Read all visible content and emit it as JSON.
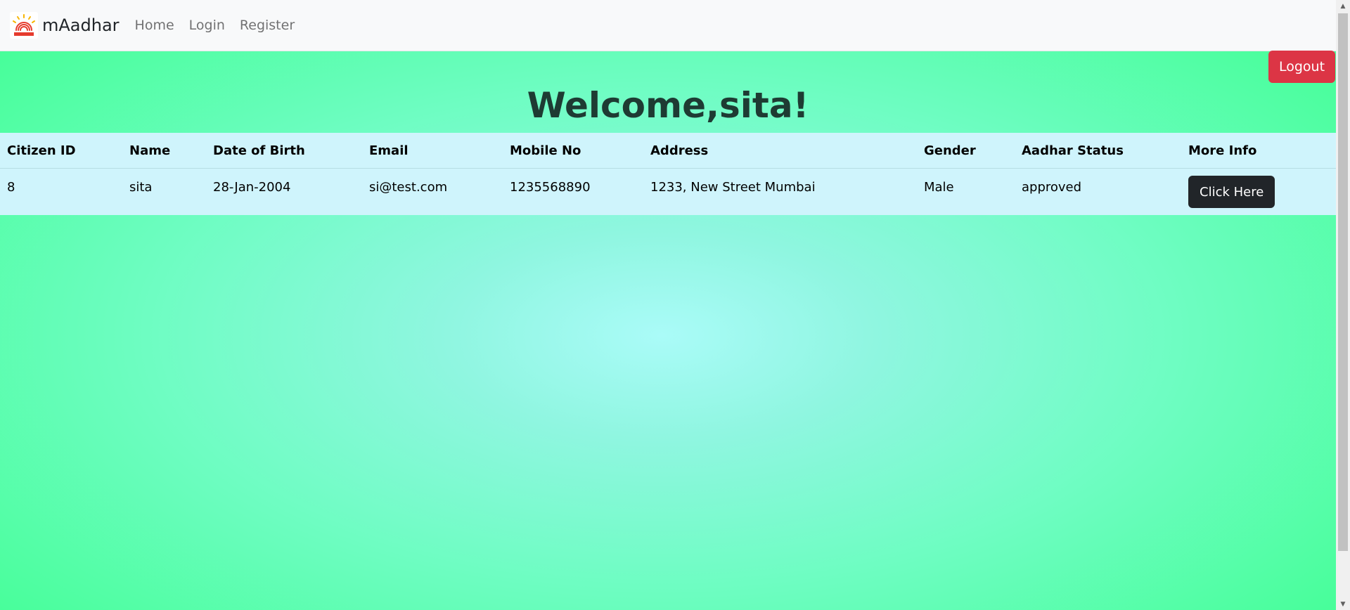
{
  "navbar": {
    "brand": "mAadhar",
    "links": [
      "Home",
      "Login",
      "Register"
    ]
  },
  "logout_label": "Logout",
  "welcome": "Welcome,sita!",
  "table": {
    "headers": [
      "Citizen ID",
      "Name",
      "Date of Birth",
      "Email",
      "Mobile No",
      "Address",
      "Gender",
      "Aadhar Status",
      "More Info"
    ],
    "rows": [
      {
        "citizen_id": "8",
        "name": "sita",
        "dob": "28-Jan-2004",
        "email": "si@test.com",
        "mobile": "1235568890",
        "address": "1233, New Street Mumbai",
        "gender": "Male",
        "status": "approved",
        "action": "Click Here"
      }
    ]
  },
  "colors": {
    "logout": "#dc3545",
    "action_button": "#212529",
    "table_bg": "#cff4fc",
    "page_bg_center": "#aafbf8",
    "page_bg_edge": "#3dfe8f"
  },
  "icons": {
    "brand_logo": "aadhaar-logo-icon",
    "scroll_up": "scroll-up-arrow-icon",
    "scroll_down": "scroll-down-arrow-icon"
  }
}
